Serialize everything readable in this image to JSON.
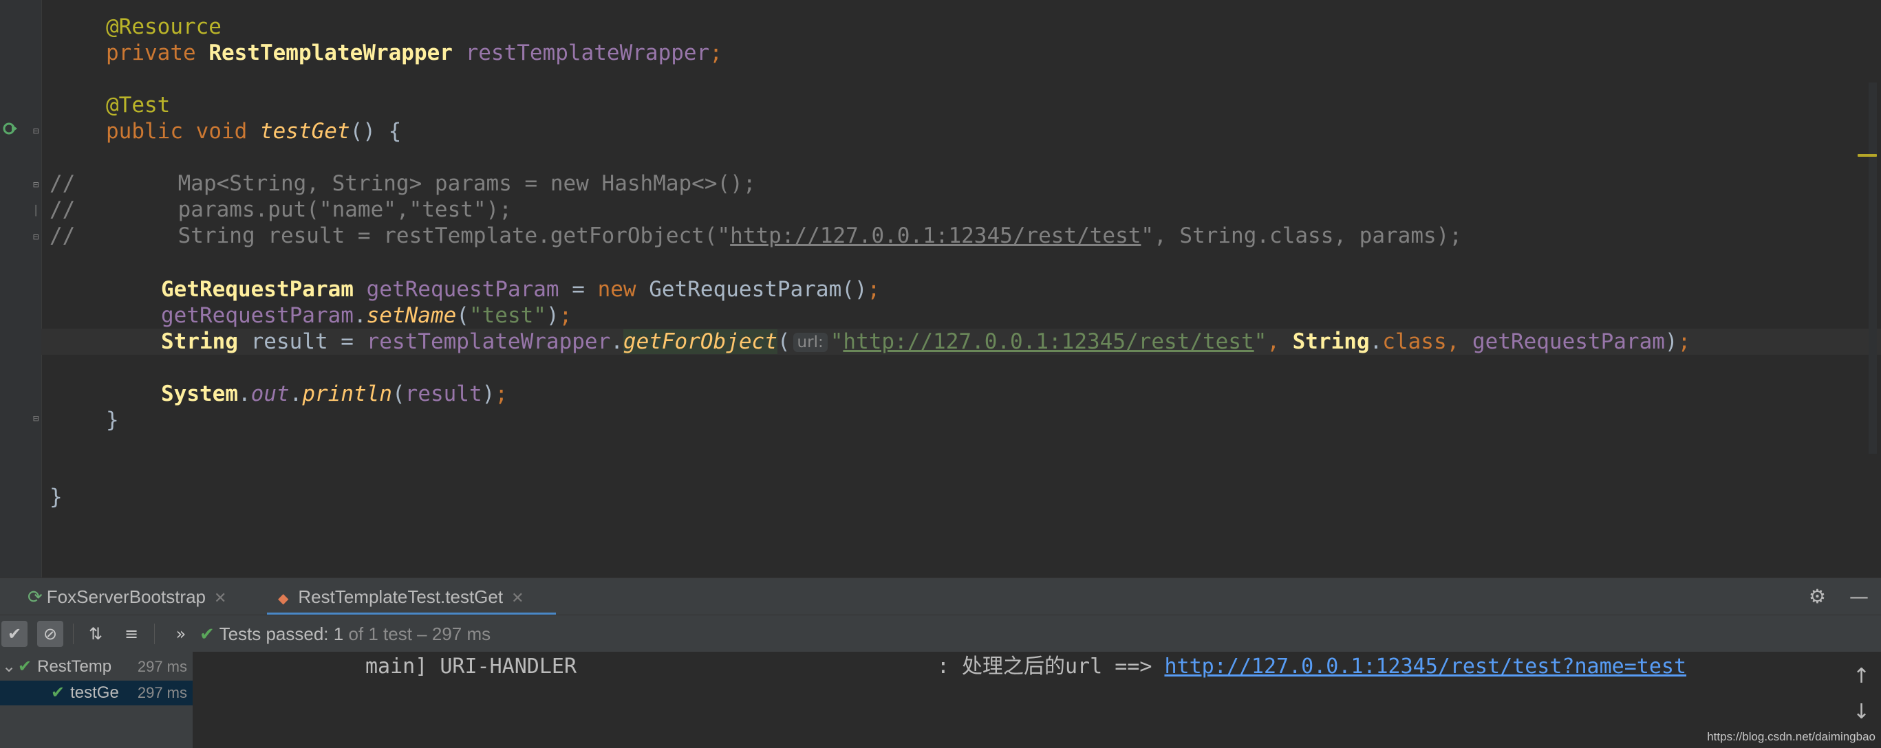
{
  "editor": {
    "lines": {
      "l1": {
        "annotation": "@Resource"
      },
      "l2": {
        "kw_private": "private",
        "type": "RestTemplateWrapper",
        "field": "restTemplateWrapper",
        "semi": ";"
      },
      "l4": {
        "annotation": "@Test"
      },
      "l5": {
        "kw_public": "public",
        "kw_void": "void",
        "method": "testGet",
        "rest": "() {"
      },
      "l7": {
        "text": "//        Map<String, String> params = new HashMap<>();"
      },
      "l8": {
        "text": "//        params.put(\"name\",\"test\");"
      },
      "l9": {
        "prefix": "//        String result = restTemplate.getForObject(\"",
        "url": "http://127.0.0.1:12345/rest/test",
        "suffix": "\", String.class, params);"
      },
      "l11": {
        "type": "GetRequestParam",
        "var": "getRequestParam",
        "eq": " = ",
        "kw_new": "new",
        "ctor": " GetRequestParam",
        "tail": "()",
        "semi": ";"
      },
      "l12": {
        "var": "getRequestParam",
        "dot": ".",
        "method": "setName",
        "open": "(",
        "arg": "\"test\"",
        "close": ")",
        "semi": ";"
      },
      "l13": {
        "type": "String",
        "var": " result = ",
        "obj": "restTemplateWrapper",
        "dot": ".",
        "method": "getForObject",
        "open": "(",
        "hint": "url:",
        "quote_open": "\"",
        "url": "http://127.0.0.1:12345/rest/test",
        "quote_close": "\"",
        "comma": ", ",
        "cls": "String",
        "dot2": ".",
        "kw_class": "class",
        "comma2": ", ",
        "arg": "getRequestParam",
        "close": ")",
        "semi": ";"
      },
      "l15": {
        "cls": "System",
        "dot": ".",
        "field": "out",
        "dot2": ".",
        "method": "println",
        "open": "(",
        "arg": "result",
        "close": ")",
        "semi": ";"
      },
      "l16": {
        "text": "}"
      },
      "l19": {
        "text": "}"
      }
    }
  },
  "tool_window": {
    "tabs": [
      {
        "label": "FoxServerBootstrap",
        "icon": "spring-boot-icon"
      },
      {
        "label": "RestTemplateTest.testGet",
        "icon": "test-run-icon",
        "active": true
      }
    ],
    "actions": {
      "settings": "⚙",
      "hide": "—"
    }
  },
  "test_toolbar": {
    "status_prefix": "Tests passed: ",
    "passed_count": "1",
    "status_suffix": " of 1 test – 297 ms"
  },
  "test_tree": [
    {
      "name": "RestTemp",
      "time": "297 ms"
    },
    {
      "name": "testGe",
      "time": "297 ms"
    }
  ],
  "console": {
    "prefix": "main] URI-HANDLER                             : 处理之后的url ==> ",
    "url": "http://127.0.0.1:12345/rest/test?name=test"
  },
  "watermark": "https://blog.csdn.net/daimingbao",
  "colors": {
    "editor_bg": "#2b2b2b",
    "keyword": "#cc7832",
    "string": "#6a8759",
    "link": "#589df6",
    "success": "#5aa65a"
  }
}
